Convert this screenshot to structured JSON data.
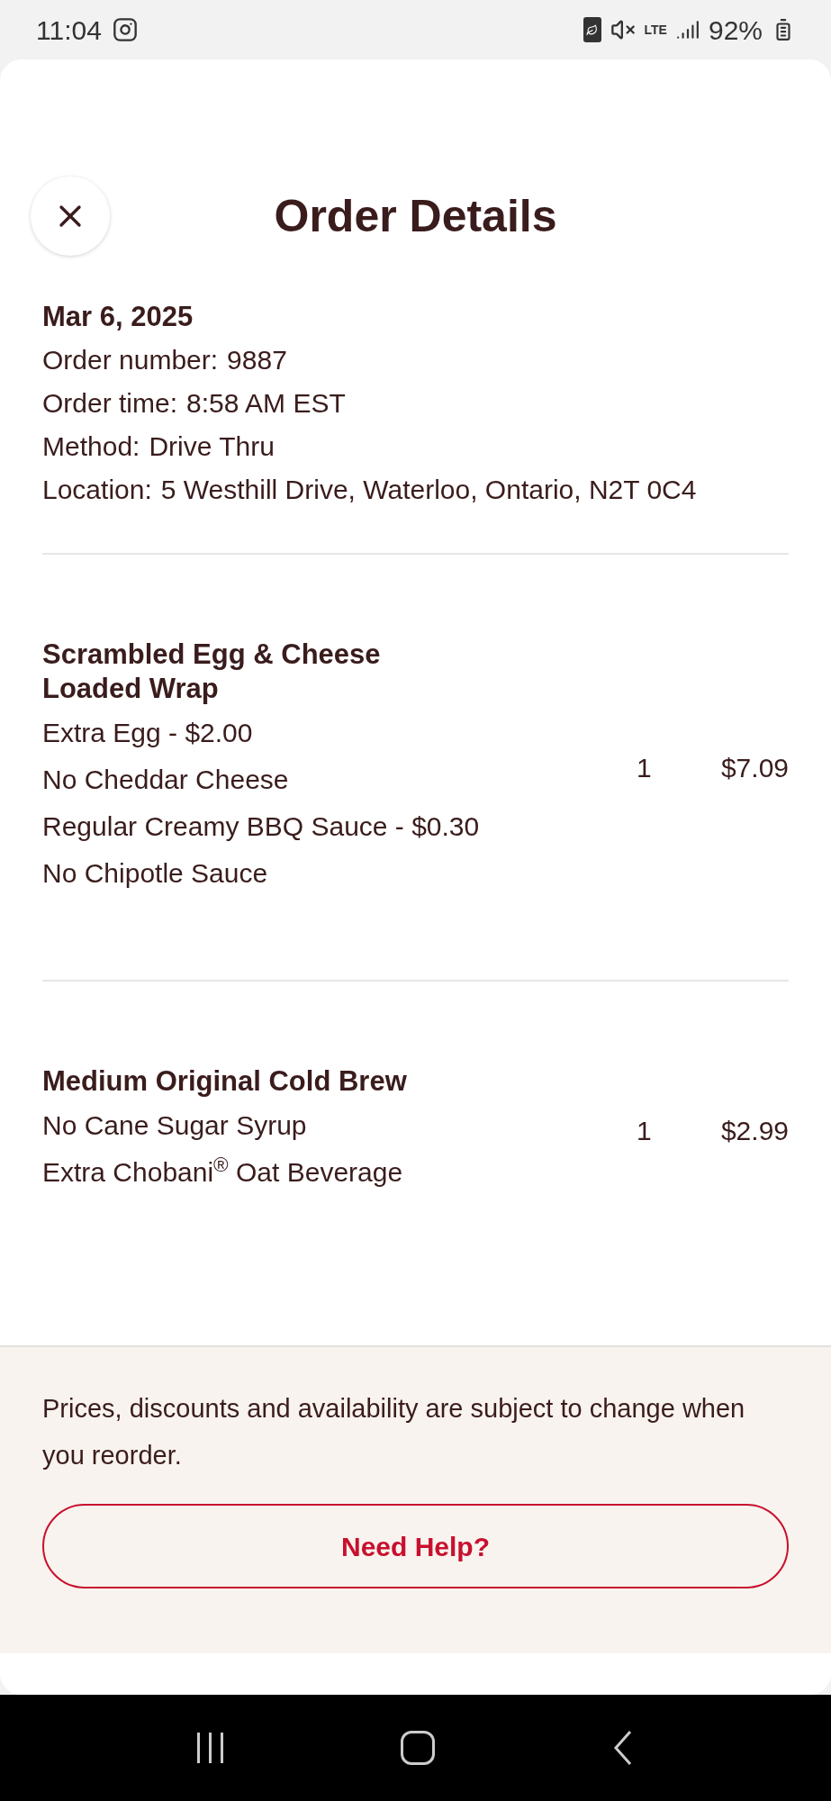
{
  "status_bar": {
    "time": "11:04",
    "network": "LTE",
    "battery": "92%"
  },
  "header": {
    "title": "Order Details"
  },
  "order": {
    "date": "Mar 6, 2025",
    "fields": [
      {
        "label": "Order number:",
        "value": "9887"
      },
      {
        "label": "Order time:",
        "value": "8:58 AM EST"
      },
      {
        "label": "Method:",
        "value": "Drive Thru"
      },
      {
        "label": "Location:",
        "value": "5 Westhill Drive, Waterloo, Ontario, N2T 0C4"
      }
    ]
  },
  "items": [
    {
      "name": "Scrambled Egg & Cheese Loaded Wrap",
      "options": [
        "Extra Egg - $2.00",
        "No Cheddar Cheese",
        "Regular Creamy BBQ Sauce - $0.30",
        "No Chipotle Sauce"
      ],
      "quantity": "1",
      "price": "$7.09"
    },
    {
      "name": "Medium Original Cold Brew",
      "options": [
        "No Cane Sugar Syrup",
        "Extra Chobani$^{®}$ Oat Beverage"
      ],
      "quantity": "1",
      "price": "$2.99"
    }
  ],
  "footer": {
    "notice": "Prices, discounts and availability are subject to change when you reorder.",
    "help_button": "Need Help?"
  }
}
